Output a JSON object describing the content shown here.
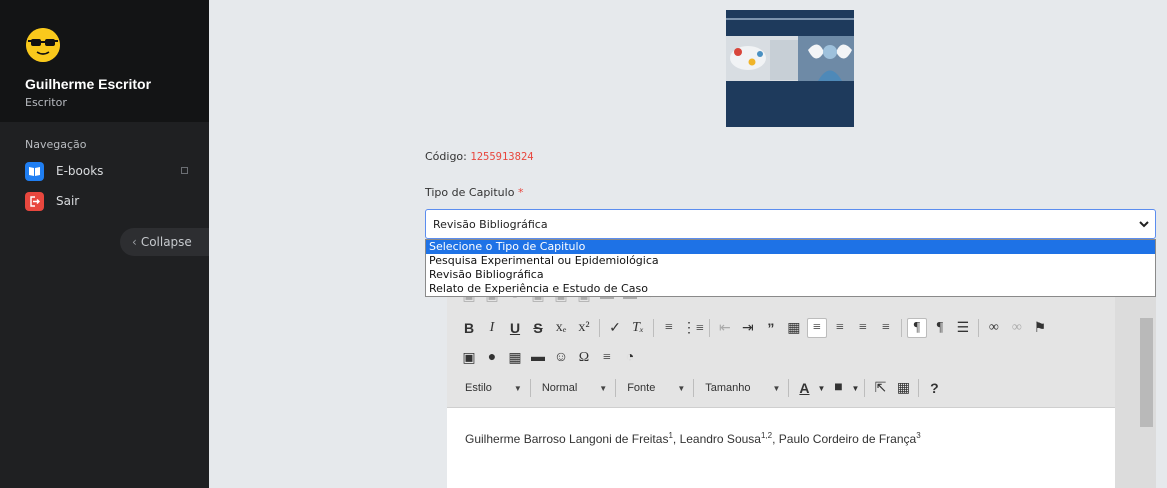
{
  "sidebar": {
    "user": {
      "name": "Guilherme Escritor",
      "role": "Escritor"
    },
    "nav_heading": "Navegação",
    "items": [
      {
        "label": "E-books",
        "icon": "book-icon",
        "color": "#1f7ef2"
      },
      {
        "label": "Sair",
        "icon": "logout-icon",
        "color": "#e8473e"
      }
    ],
    "collapse_label": "Collapse"
  },
  "form": {
    "codigo_label": "Código:",
    "codigo_value": "1255913824",
    "tipo_label": "Tipo de Capitulo",
    "required_mark": "*",
    "select_value": "Revisão Bibliográfica",
    "options": [
      "Selecione o Tipo de Capitulo",
      "Pesquisa Experimental ou Epidemiológica",
      "Revisão Bibliográfica",
      "Relato de Experiência e Estudo de Caso"
    ],
    "highlighted_option_index": 0
  },
  "editor": {
    "toolbar": {
      "style_label": "Estilo",
      "format_label": "Normal",
      "font_label": "Fonte",
      "size_label": "Tamanho",
      "help_label": "?"
    },
    "content": {
      "author1": "Guilherme Barroso Langoni de Freitas",
      "author1_sup": "1",
      "author2": "Leandro Sousa",
      "author2_sup": "1,2",
      "author3": "Paulo Cordeiro de França",
      "author3_sup": "3",
      "sep": ", "
    }
  },
  "colors": {
    "sidebar_bg": "#1f2022",
    "accent_blue": "#1e72e6",
    "accent_red": "#e8473e",
    "avatar_yellow": "#f9c91c"
  }
}
